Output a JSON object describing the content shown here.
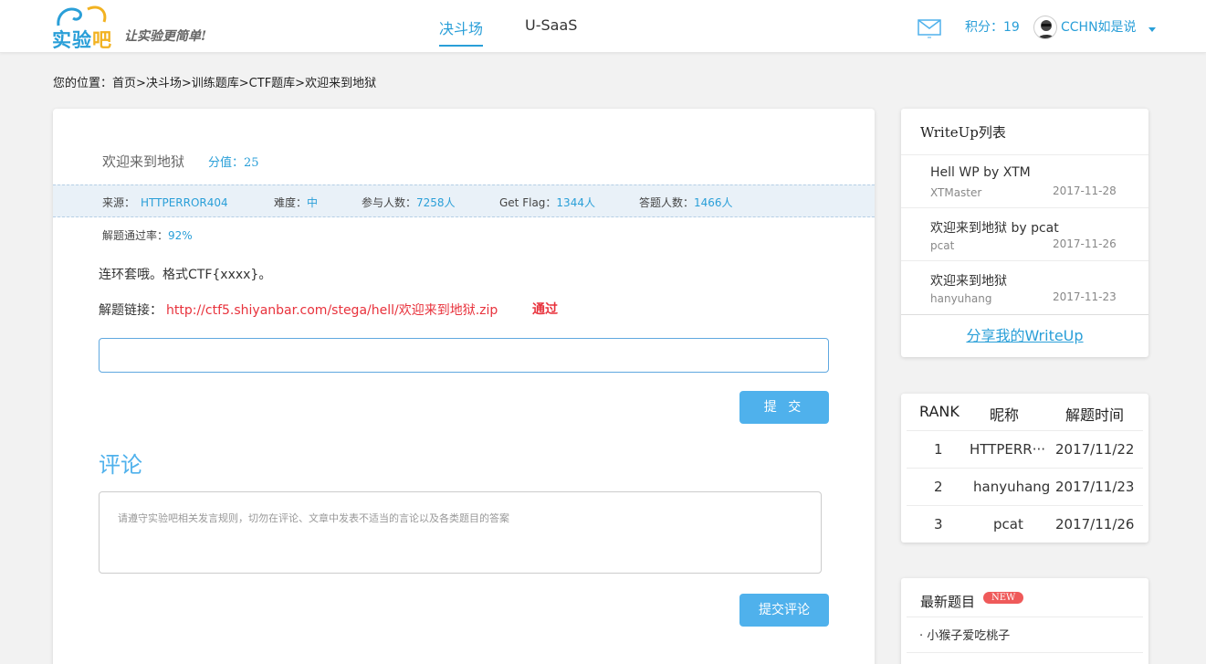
{
  "header": {
    "logo_main": "实验",
    "logo_accent": "吧",
    "slogan": "让实验更简单!",
    "nav": [
      {
        "label": "决斗场",
        "active": true
      },
      {
        "label": "U-SaaS",
        "active": false
      }
    ],
    "points_label": "积分：",
    "points_value": "19",
    "username": "CCHN如是说"
  },
  "breadcrumb": "您的位置：首页>决斗场>训练题库>CTF题库>欢迎来到地狱",
  "problem": {
    "title": "欢迎来到地狱",
    "score_label": "分值：",
    "score_value": "25",
    "source_label": "来源：",
    "source_value": "HTTPERROR404",
    "difficulty_label": "难度：",
    "difficulty_value": "中",
    "participants_label": "参与人数：",
    "participants_value": "7258人",
    "getflag_label": "Get Flag：",
    "getflag_value": "1344人",
    "answers_label": "答题人数：",
    "answers_value": "1466人",
    "pass_rate_label": "解题通过率：",
    "pass_rate_value": "92%",
    "description": "连环套哦。格式CTF{xxxx}。",
    "link_label": "解题链接：",
    "link_url": "http://ctf5.shiyanbar.com/stega/hell/欢迎来到地狱.zip",
    "status": "通过",
    "flag_value": "",
    "submit_label": "提 交"
  },
  "comments": {
    "heading": "评论",
    "placeholder": "请遵守实验吧相关发言规则，切勿在评论、文章中发表不适当的言论以及各类题目的答案",
    "submit_label": "提交评论"
  },
  "writeups": {
    "title": "WriteUp列表",
    "items": [
      {
        "name": "Hell WP by XTM",
        "author": "XTMaster",
        "date": "2017-11-28"
      },
      {
        "name": "欢迎来到地狱 by pcat",
        "author": "pcat",
        "date": "2017-11-26"
      },
      {
        "name": "欢迎来到地狱",
        "author": "hanyuhang",
        "date": "2017-11-23"
      }
    ],
    "share_label": "分享我的WriteUp"
  },
  "ranking": {
    "headers": [
      "RANK",
      "昵称",
      "解题时间"
    ],
    "rows": [
      {
        "rank": "1",
        "name": "HTTPERR···",
        "time": "2017/11/22"
      },
      {
        "rank": "2",
        "name": "hanyuhang",
        "time": "2017/11/23"
      },
      {
        "rank": "3",
        "name": "pcat",
        "time": "2017/11/26"
      }
    ]
  },
  "latest": {
    "title": "最新题目",
    "badge": "NEW",
    "items": [
      "· 小猴子爱吃桃子"
    ]
  },
  "colors": {
    "accent": "#2a9fd8",
    "button": "#4fb1ec",
    "danger": "#e8323c",
    "badge": "#ef5a5a"
  }
}
